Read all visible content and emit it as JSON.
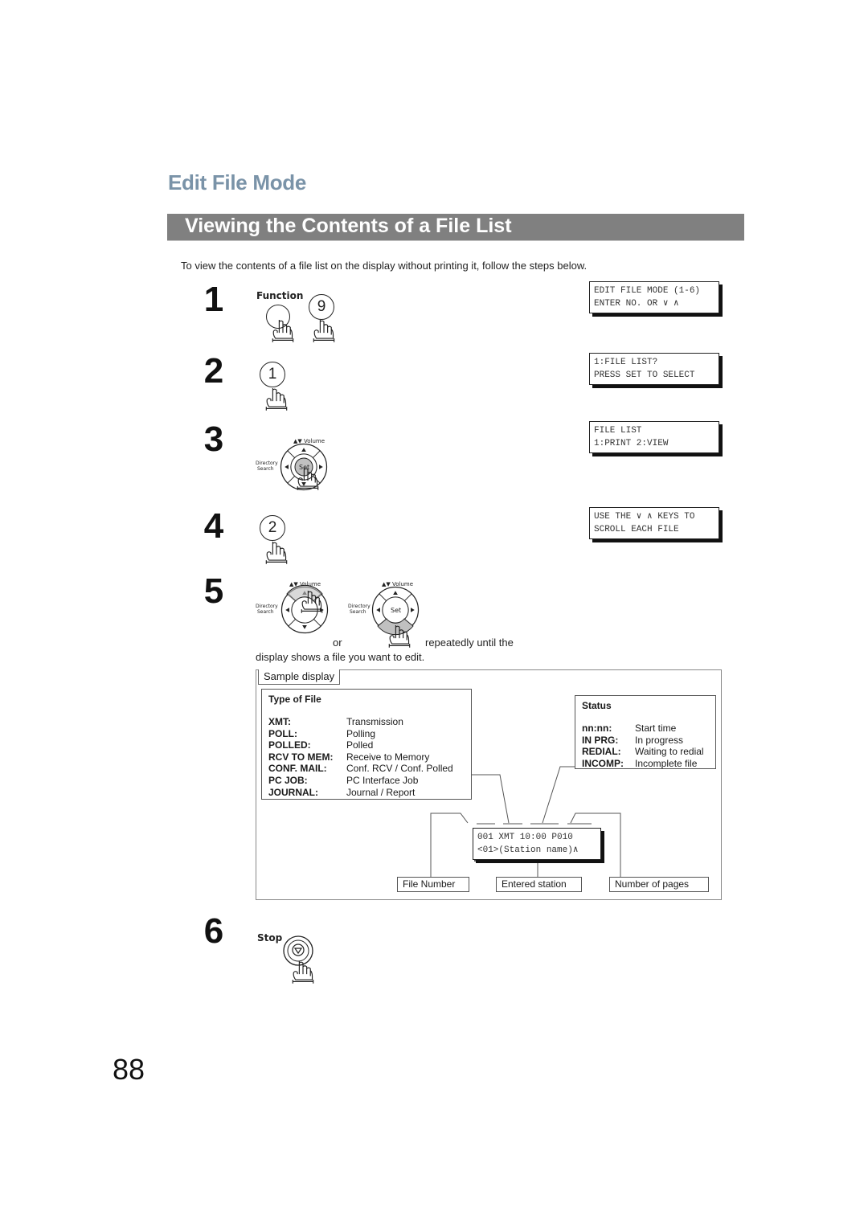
{
  "section_title": "Edit File Mode",
  "page_title": "Viewing the Contents of a File List",
  "intro": "To view the contents of a file list on the display without printing it, follow the steps below.",
  "steps": [
    {
      "number": "1",
      "keys": [
        "Function",
        "9"
      ],
      "display": [
        "EDIT FILE MODE (1-6)",
        "ENTER NO. OR ∨ ∧"
      ]
    },
    {
      "number": "2",
      "keys": [
        "1"
      ],
      "display": [
        "1:FILE LIST?",
        "PRESS SET TO SELECT"
      ]
    },
    {
      "number": "3",
      "keys": [
        "Set"
      ],
      "display": [
        "FILE LIST",
        "1:PRINT 2:VIEW"
      ]
    },
    {
      "number": "4",
      "keys": [
        "2"
      ],
      "display": [
        "USE THE ∨ ∧ KEYS TO",
        "SCROLL EACH FILE"
      ]
    },
    {
      "number": "5",
      "or_text": "or",
      "instruction_tail": "repeatedly until the",
      "instruction_line2": "display shows a file you want to edit."
    },
    {
      "number": "6",
      "keys": [
        "Stop"
      ]
    }
  ],
  "nav_key": {
    "volume_label": "Volume",
    "directory_label": "Directory",
    "search_label": "Search",
    "set_label": "Set"
  },
  "sample": {
    "tab_label": "Sample display",
    "type_of_file": {
      "header": "Type of File",
      "rows": [
        {
          "key": "XMT:",
          "value": "Transmission"
        },
        {
          "key": "POLL:",
          "value": "Polling"
        },
        {
          "key": "POLLED:",
          "value": "Polled"
        },
        {
          "key": "RCV TO MEM:",
          "value": "Receive to Memory"
        },
        {
          "key": "CONF. MAIL:",
          "value": "Conf. RCV / Conf. Polled"
        },
        {
          "key": "PC JOB:",
          "value": "PC Interface Job"
        },
        {
          "key": "JOURNAL:",
          "value": "Journal / Report"
        }
      ]
    },
    "status": {
      "header": "Status",
      "rows": [
        {
          "key": "nn:nn:",
          "value": "Start time"
        },
        {
          "key": "IN PRG:",
          "value": "In progress"
        },
        {
          "key": "REDIAL:",
          "value": "Waiting to redial"
        },
        {
          "key": "INCOMP:",
          "value": "Incomplete file"
        }
      ]
    },
    "display": [
      "001 XMT 10:00 P010",
      "<01>(Station name)∧"
    ],
    "callouts": {
      "file_number": "File Number",
      "entered_station": "Entered station",
      "number_of_pages": "Number of pages"
    }
  },
  "page_number": "88",
  "colors": {
    "section_title": "#7a93a8",
    "title_bar": "#808080",
    "key_pressed": "#c0c0c0"
  }
}
